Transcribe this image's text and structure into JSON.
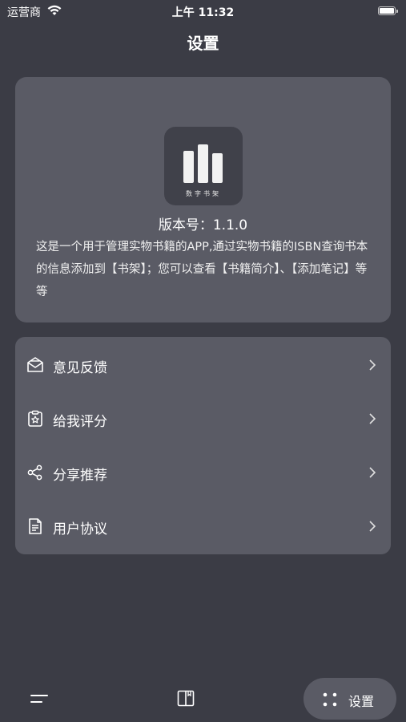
{
  "status_bar": {
    "carrier": "运营商",
    "time": "上午 11:32"
  },
  "nav": {
    "title": "设置"
  },
  "about": {
    "logo_text": "数字书架",
    "version": "版本号：1.1.0",
    "description": "这是一个用于管理实物书籍的APP,通过实物书籍的ISBN查询书本的信息添加到【书架】；您可以查看【书籍简介】、【添加笔记】等等"
  },
  "menu": {
    "items": [
      {
        "label": "意见反馈",
        "icon": "feedback-icon"
      },
      {
        "label": "给我评分",
        "icon": "rate-icon"
      },
      {
        "label": "分享推荐",
        "icon": "share-icon"
      },
      {
        "label": "用户协议",
        "icon": "agreement-icon"
      }
    ]
  },
  "tab_bar": {
    "settings_label": "设置",
    "tabs": [
      "menu-icon",
      "book-icon",
      "settings-dots-icon"
    ]
  }
}
